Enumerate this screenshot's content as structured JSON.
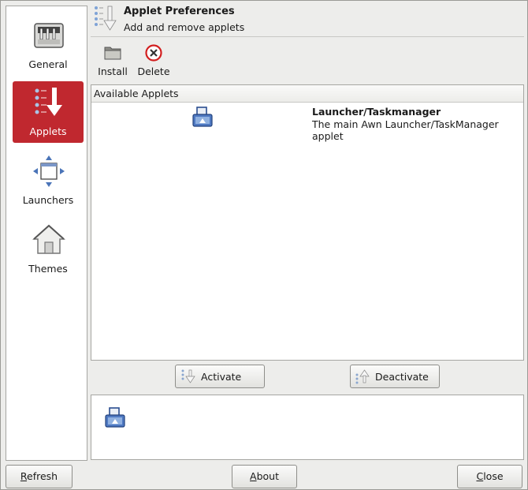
{
  "sidebar": {
    "items": [
      {
        "label": "General",
        "icon": "control-panel-icon",
        "active": false
      },
      {
        "label": "Applets",
        "icon": "applets-list-icon",
        "active": true
      },
      {
        "label": "Launchers",
        "icon": "launchers-window-icon",
        "active": false
      },
      {
        "label": "Themes",
        "icon": "home-icon",
        "active": false
      }
    ],
    "active_color": "#c0282f"
  },
  "header": {
    "title": "Applet Preferences",
    "subtitle": "Add and remove applets"
  },
  "toolbar": {
    "install_label": "Install",
    "delete_label": "Delete"
  },
  "applets": {
    "column_header": "Available Applets",
    "rows": [
      {
        "name": "Launcher/Taskmanager",
        "description": "The main Awn Launcher/TaskManager applet",
        "icon": "launcher-applet-icon"
      }
    ]
  },
  "actions": {
    "activate_label": "Activate",
    "deactivate_label": "Deactivate"
  },
  "active_applets": [
    {
      "icon": "launcher-applet-icon"
    }
  ],
  "footer": {
    "refresh_mnemonic": "R",
    "refresh_rest": "efresh",
    "about_mnemonic": "A",
    "about_rest": "bout",
    "close_mnemonic": "C",
    "close_rest": "lose"
  }
}
